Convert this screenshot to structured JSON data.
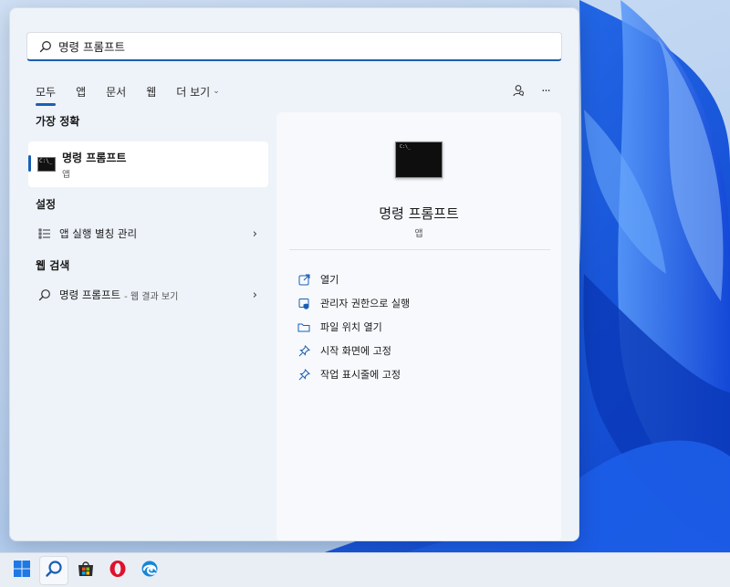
{
  "search": {
    "value": "명령 프롬프트"
  },
  "tabs": [
    {
      "label": "모두",
      "active": true
    },
    {
      "label": "앱"
    },
    {
      "label": "문서"
    },
    {
      "label": "웹"
    },
    {
      "label": "더 보기"
    }
  ],
  "top_right": {
    "icons": [
      "account-icon",
      "more-icon"
    ],
    "more_glyph": "···"
  },
  "best_match": {
    "section_title": "가장 정확",
    "name": "명령 프롬프트",
    "type": "앱",
    "icon": "command-prompt-icon"
  },
  "settings": {
    "section_title": "설정",
    "items": [
      {
        "label": "앱 실행 별칭 관리",
        "icon": "list-icon"
      }
    ]
  },
  "web": {
    "section_title": "웹 검색",
    "items": [
      {
        "label": "명령 프롬프트",
        "hint": "- 웹 결과 보기",
        "icon": "search-icon"
      }
    ]
  },
  "detail": {
    "name": "명령 프롬프트",
    "type": "앱",
    "actions": [
      {
        "label": "열기",
        "icon": "open-icon"
      },
      {
        "label": "관리자 권한으로 실행",
        "icon": "shield-icon"
      },
      {
        "label": "파일 위치 열기",
        "icon": "folder-icon"
      },
      {
        "label": "시작 화면에 고정",
        "icon": "pin-icon"
      },
      {
        "label": "작업 표시줄에 고정",
        "icon": "pin-icon"
      }
    ]
  },
  "taskbar": {
    "items": [
      {
        "icon": "windows-start-icon"
      },
      {
        "icon": "search-icon",
        "active": true
      },
      {
        "icon": "microsoft-store-icon"
      },
      {
        "icon": "opera-icon"
      },
      {
        "icon": "edge-icon"
      }
    ]
  },
  "colors": {
    "accent": "#1a5fb4",
    "panel": "#eef3fa",
    "wallpaper_blue": "#1a56e0"
  }
}
